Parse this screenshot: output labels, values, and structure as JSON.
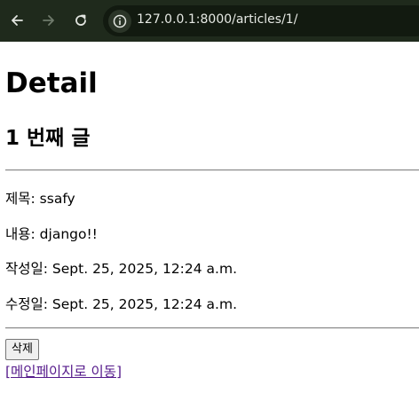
{
  "browser": {
    "url": "127.0.0.1:8000/articles/1/",
    "icons": {
      "back": "back-arrow-icon",
      "forward": "forward-arrow-icon",
      "reload": "reload-icon",
      "site_info": "info-icon"
    }
  },
  "page": {
    "title": "Detail",
    "subtitle": "1 번째 글",
    "fields": {
      "title_label": "제목: ssafy",
      "content_label": "내용: django!!",
      "created_label": "작성일: Sept. 25, 2025, 12:24 a.m.",
      "updated_label": "수정일: Sept. 25, 2025, 12:24 a.m."
    },
    "delete_button": "삭제",
    "home_link": "[메인페이지로 이동]"
  },
  "colors": {
    "toolbar_bg": "#1f2a1c",
    "visited_link": "#551a8b"
  }
}
